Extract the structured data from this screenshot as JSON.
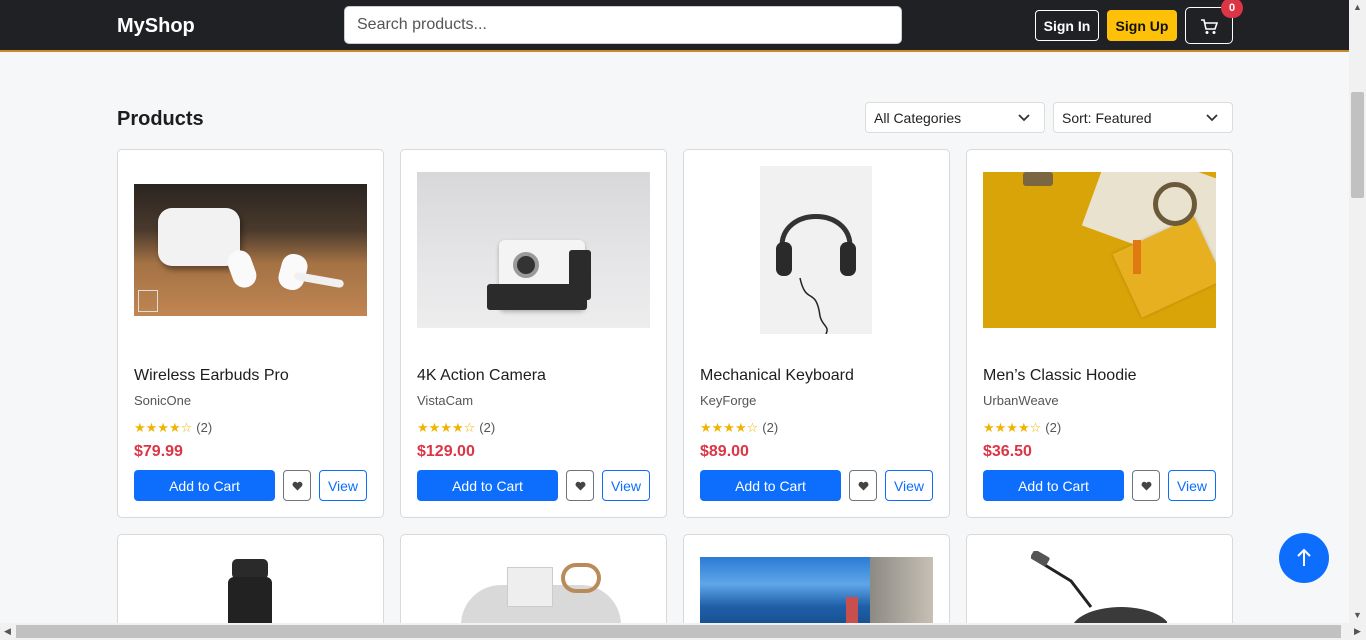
{
  "header": {
    "brand": "MyShop",
    "search_placeholder": "Search products...",
    "sign_in": "Sign In",
    "sign_up": "Sign Up",
    "cart_count": "0",
    "cart_icon": "cart-icon"
  },
  "toolbar": {
    "title": "Products",
    "category_select": "All Categories",
    "sort_select": "Sort: Featured"
  },
  "products": [
    {
      "name": "Wireless Earbuds Pro",
      "brand": "SonicOne",
      "stars": "★★★★☆",
      "reviews": "(2)",
      "price": "$79.99",
      "add": "Add to Cart",
      "view": "View"
    },
    {
      "name": "4K Action Camera",
      "brand": "VistaCam",
      "stars": "★★★★☆",
      "reviews": "(2)",
      "price": "$129.00",
      "add": "Add to Cart",
      "view": "View"
    },
    {
      "name": "Mechanical Keyboard",
      "brand": "KeyForge",
      "stars": "★★★★☆",
      "reviews": "(2)",
      "price": "$89.00",
      "add": "Add to Cart",
      "view": "View"
    },
    {
      "name": "Men’s Classic Hoodie",
      "brand": "UrbanWeave",
      "stars": "★★★★☆",
      "reviews": "(2)",
      "price": "$36.50",
      "add": "Add to Cart",
      "view": "View"
    }
  ],
  "colors": {
    "primary": "#0d6efd",
    "accent": "#ffc107",
    "price": "#dc3545",
    "navbar": "#1f2125"
  }
}
